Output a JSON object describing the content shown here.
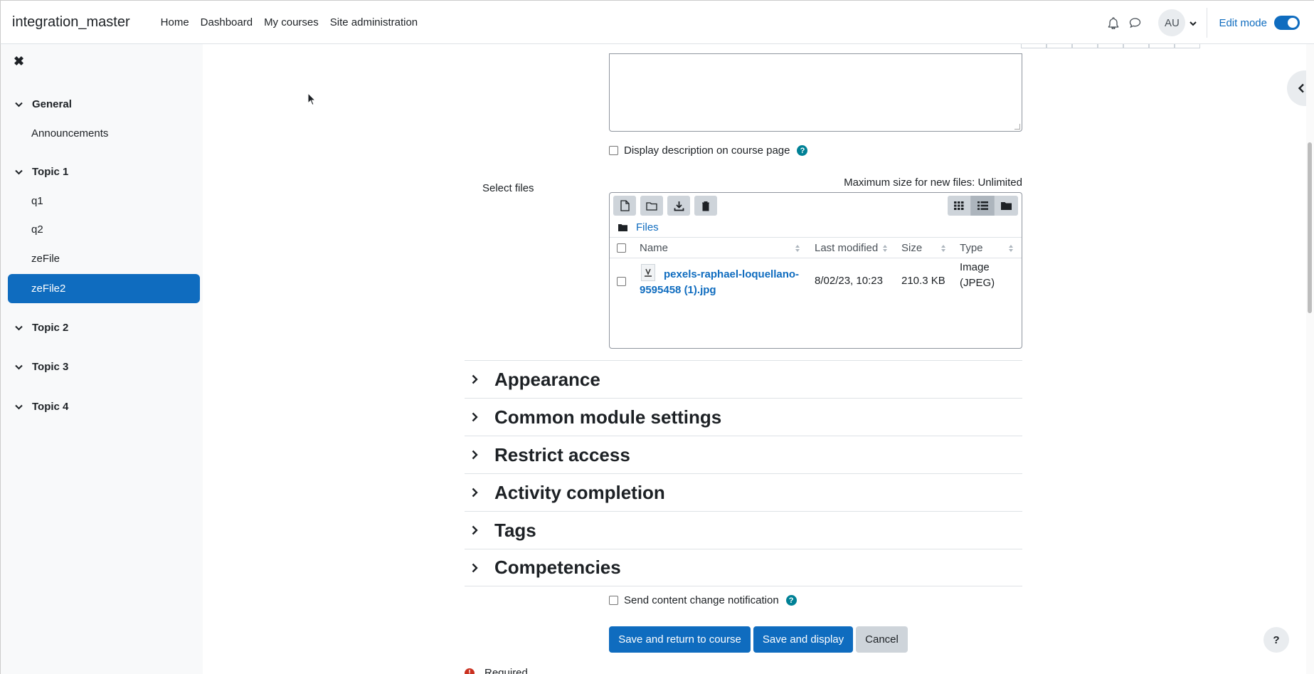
{
  "navbar": {
    "brand": "integration_master",
    "links": [
      "Home",
      "Dashboard",
      "My courses",
      "Site administration"
    ],
    "avatar_initials": "AU",
    "edit_mode_label": "Edit mode",
    "edit_mode_on": true
  },
  "course_index": {
    "sections": [
      {
        "title": "General",
        "items": [
          "Announcements"
        ]
      },
      {
        "title": "Topic 1",
        "items": [
          "q1",
          "q2",
          "zeFile",
          "zeFile2"
        ]
      },
      {
        "title": "Topic 2",
        "items": []
      },
      {
        "title": "Topic 3",
        "items": []
      },
      {
        "title": "Topic 4",
        "items": []
      }
    ],
    "active_item": "zeFile2"
  },
  "form": {
    "display_description_label": "Display description on course page",
    "select_files_label": "Select files",
    "max_size_text": "Maximum size for new files: Unlimited",
    "filemanager": {
      "path_label": "Files",
      "columns": [
        "Name",
        "Last modified",
        "Size",
        "Type"
      ],
      "rows": [
        {
          "name_line1": "pexels-raphael-loquellano-",
          "name_line2": "9595458 (1).jpg",
          "modified": "8/02/23, 10:23",
          "size": "210.3 KB",
          "type_line1": "Image",
          "type_line2": "(JPEG)"
        }
      ]
    },
    "sections": [
      "Appearance",
      "Common module settings",
      "Restrict access",
      "Activity completion",
      "Tags",
      "Competencies"
    ],
    "notification_label": "Send content change notification",
    "buttons": {
      "save_return": "Save and return to course",
      "save_display": "Save and display",
      "cancel": "Cancel"
    },
    "required_label": "Required"
  },
  "help_button": "?",
  "colors": {
    "primary": "#0f6cbf",
    "help": "#008196",
    "required": "#ca3120"
  }
}
